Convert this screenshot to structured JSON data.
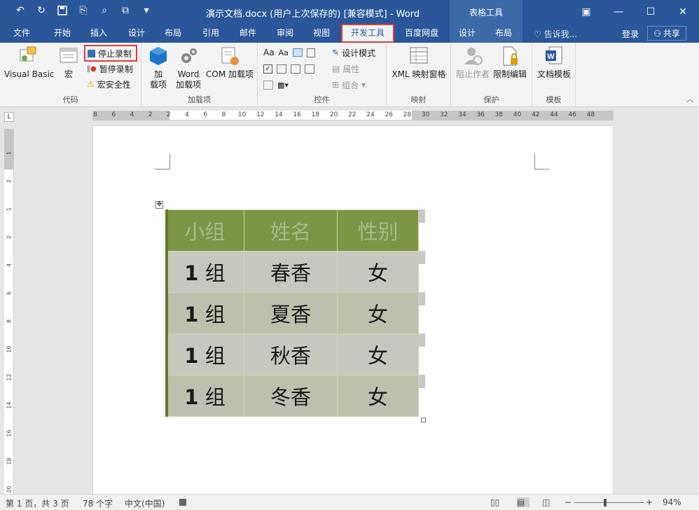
{
  "window": {
    "title": "演示文档.docx (用户上次保存的) [兼容模式] - Word",
    "context_tool": "表格工具",
    "controls": [
      "restore-ribbon",
      "minimize",
      "maximize",
      "close"
    ]
  },
  "tabs": [
    {
      "label": "文件"
    },
    {
      "label": "开始"
    },
    {
      "label": "插入"
    },
    {
      "label": "设计"
    },
    {
      "label": "布局"
    },
    {
      "label": "引用"
    },
    {
      "label": "邮件"
    },
    {
      "label": "审阅"
    },
    {
      "label": "视图"
    },
    {
      "label": "开发工具",
      "active": true
    },
    {
      "label": "百度网盘"
    },
    {
      "label": "设计",
      "context": true
    },
    {
      "label": "布局",
      "context": true
    }
  ],
  "tell_me": "告诉我...",
  "login": "登录",
  "share": "共享",
  "ribbon": {
    "code": {
      "label": "代码",
      "visual_basic": "Visual Basic",
      "macro": "宏",
      "stop_recording": "停止录制",
      "pause_recording": "暂停录制",
      "macro_security": "宏安全性"
    },
    "addins": {
      "label": "加载项",
      "addins": "加\n载项",
      "addins_line1": "加",
      "addins_line2": "载项",
      "word_addins_line1": "Word",
      "word_addins_line2": "加载项",
      "com_addins": "COM 加载项"
    },
    "controls": {
      "label": "控件",
      "design_mode": "设计模式",
      "properties": "属性",
      "group": "组合"
    },
    "mapping": {
      "label": "映射",
      "xml_pane": "XML 映射窗格"
    },
    "protect": {
      "label": "保护",
      "block_authors": "阻止作者",
      "restrict_editing": "限制编辑"
    },
    "templates": {
      "label": "模板",
      "document_template": "文档模板"
    }
  },
  "ruler": {
    "h_ticks": [
      "8",
      "6",
      "4",
      "2",
      "2",
      "4",
      "6",
      "8",
      "10",
      "12",
      "14",
      "16",
      "18",
      "20",
      "22",
      "24",
      "26",
      "28",
      "30",
      "32",
      "34",
      "36",
      "38",
      "40",
      "42",
      "44",
      "46",
      "48"
    ],
    "v_ticks": [
      "1",
      "2",
      "1",
      "2",
      "4",
      "6",
      "8",
      "10",
      "12",
      "14",
      "16",
      "18",
      "20"
    ]
  },
  "table": {
    "headers": [
      "小组",
      "姓名",
      "性别"
    ],
    "rows": [
      {
        "group_num": "1",
        "group_unit": "组",
        "name": "春香",
        "gender": "女"
      },
      {
        "group_num": "1",
        "group_unit": "组",
        "name": "夏香",
        "gender": "女"
      },
      {
        "group_num": "1",
        "group_unit": "组",
        "name": "秋香",
        "gender": "女"
      },
      {
        "group_num": "1",
        "group_unit": "组",
        "name": "冬香",
        "gender": "女"
      }
    ]
  },
  "status": {
    "page": "第 1 页，共 3 页",
    "words": "78 个字",
    "language": "中文(中国)",
    "zoom": "94%"
  },
  "colors": {
    "brand": "#2b579a",
    "highlight": "#e23b3b",
    "table_header": "#7a9544"
  }
}
